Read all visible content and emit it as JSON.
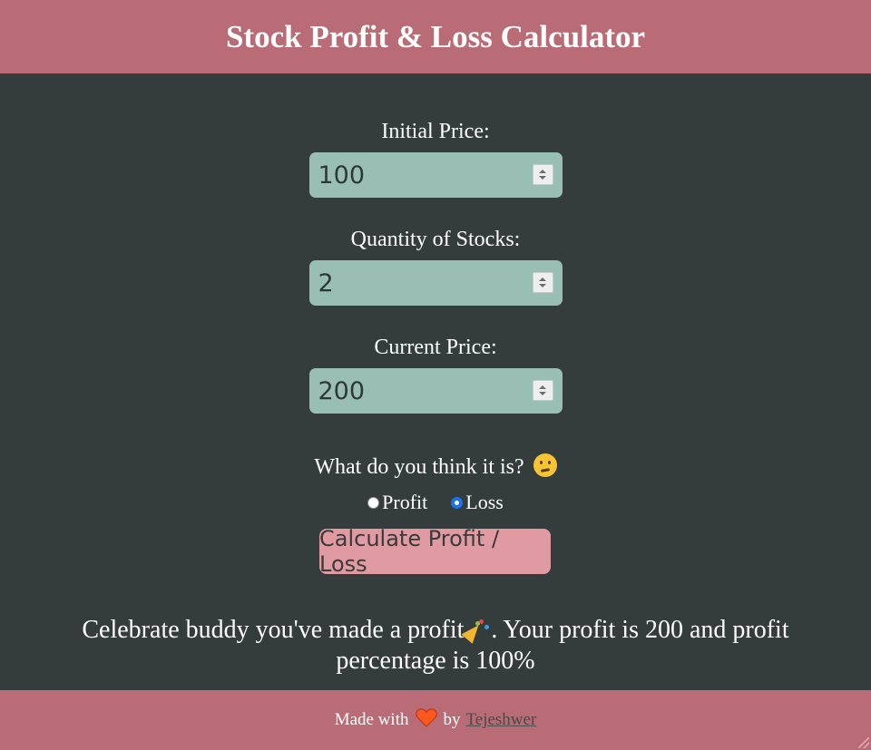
{
  "header": {
    "title": "Stock Profit & Loss Calculator"
  },
  "form": {
    "initial_price": {
      "label": "Initial Price:",
      "value": "100"
    },
    "quantity": {
      "label": "Quantity of Stocks:",
      "value": "2"
    },
    "current_price": {
      "label": "Current Price:",
      "value": "200"
    },
    "question": "What do you think it is?",
    "question_emoji": "thinking-face-icon",
    "options": [
      {
        "label": "Profit",
        "checked": false
      },
      {
        "label": "Loss",
        "checked": true
      }
    ],
    "calculate_label": "Calculate Profit / Loss"
  },
  "result": {
    "text_before": "Celebrate buddy you've made a profit",
    "emoji": "party-popper-icon",
    "text_after": ". Your profit is 200 and profit percentage is 100%"
  },
  "footer": {
    "made_with": "Made with",
    "heart": "heart-icon",
    "by": "by",
    "author": "Tejeshwer"
  },
  "colors": {
    "header_bg": "#b96b76",
    "body_bg": "#353c3c",
    "input_bg": "#99bfb4",
    "button_bg": "#e09aa2",
    "heart": "#ff5722"
  }
}
